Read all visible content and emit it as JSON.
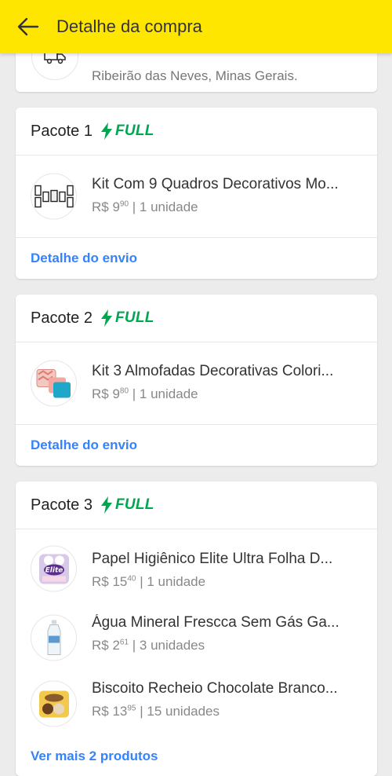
{
  "header": {
    "title": "Detalhe da compra"
  },
  "address": {
    "text": "Ribeirão das Neves, Minas Gerais."
  },
  "full_label": "FULL",
  "colors": {
    "accent": "#ffe600",
    "full_green": "#00a650",
    "link_blue": "#3483fa"
  },
  "packages": [
    {
      "title": "Pacote 1",
      "items": [
        {
          "name": "Kit Com 9 Quadros Decorativos Mo...",
          "price_int": "R$ 9",
          "price_cents": "90",
          "qty": "| 1 unidade",
          "thumb_icon": "frames-thumb"
        }
      ],
      "link": "Detalhe do envio"
    },
    {
      "title": "Pacote 2",
      "items": [
        {
          "name": "Kit 3 Almofadas Decorativas Colori...",
          "price_int": "R$ 9",
          "price_cents": "80",
          "qty": "| 1 unidade",
          "thumb_icon": "pillows-thumb"
        }
      ],
      "link": "Detalhe do envio"
    },
    {
      "title": "Pacote 3",
      "items": [
        {
          "name": "Papel Higiênico Elite Ultra Folha D...",
          "price_int": "R$ 15",
          "price_cents": "40",
          "qty": "| 1 unidade",
          "thumb_icon": "toilet-paper-thumb"
        },
        {
          "name": "Água Mineral Frescca Sem Gás Ga...",
          "price_int": "R$ 2",
          "price_cents": "61",
          "qty": "| 3 unidades",
          "thumb_icon": "water-bottle-thumb"
        },
        {
          "name": "Biscoito Recheio Chocolate Branco...",
          "price_int": "R$ 13",
          "price_cents": "95",
          "qty": "| 15 unidades",
          "thumb_icon": "biscuit-thumb"
        }
      ],
      "link": "Ver mais 2 produtos"
    }
  ]
}
